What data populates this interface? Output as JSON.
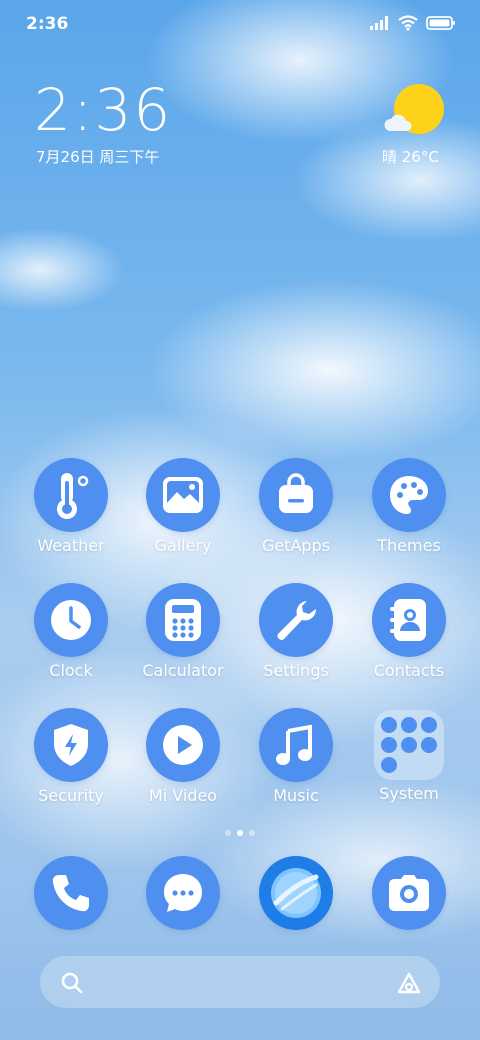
{
  "status_bar": {
    "time": "2:36",
    "icons": [
      "signal-icon",
      "wifi-icon",
      "battery-icon"
    ]
  },
  "clock_widget": {
    "time": "2:36",
    "date": "7月26日 周三下午"
  },
  "weather_widget": {
    "text": "晴 26°C",
    "icon": "sun-cloud-icon"
  },
  "apps": [
    {
      "label": "Weather",
      "icon": "thermometer-icon"
    },
    {
      "label": "Gallery",
      "icon": "image-icon"
    },
    {
      "label": "GetApps",
      "icon": "shopping-bag-icon"
    },
    {
      "label": "Themes",
      "icon": "palette-icon"
    },
    {
      "label": "Clock",
      "icon": "clock-icon"
    },
    {
      "label": "Calculator",
      "icon": "calculator-icon"
    },
    {
      "label": "Settings",
      "icon": "wrench-icon"
    },
    {
      "label": "Contacts",
      "icon": "contacts-book-icon"
    },
    {
      "label": "Security",
      "icon": "shield-bolt-icon"
    },
    {
      "label": "Mi Video",
      "icon": "play-icon"
    },
    {
      "label": "Music",
      "icon": "music-note-icon"
    },
    {
      "label": "System",
      "icon": "folder-icon"
    }
  ],
  "page_indicator": {
    "pages": 3,
    "current": 2
  },
  "dock": [
    {
      "icon": "phone-icon"
    },
    {
      "icon": "message-icon"
    },
    {
      "icon": "browser-planet-icon"
    },
    {
      "icon": "camera-icon"
    }
  ],
  "search_bar": {
    "left_icon": "search-icon",
    "right_icon": "app-vault-icon"
  },
  "colors": {
    "icon_bg": "#4f8ff0",
    "sun": "#ffd21a"
  }
}
